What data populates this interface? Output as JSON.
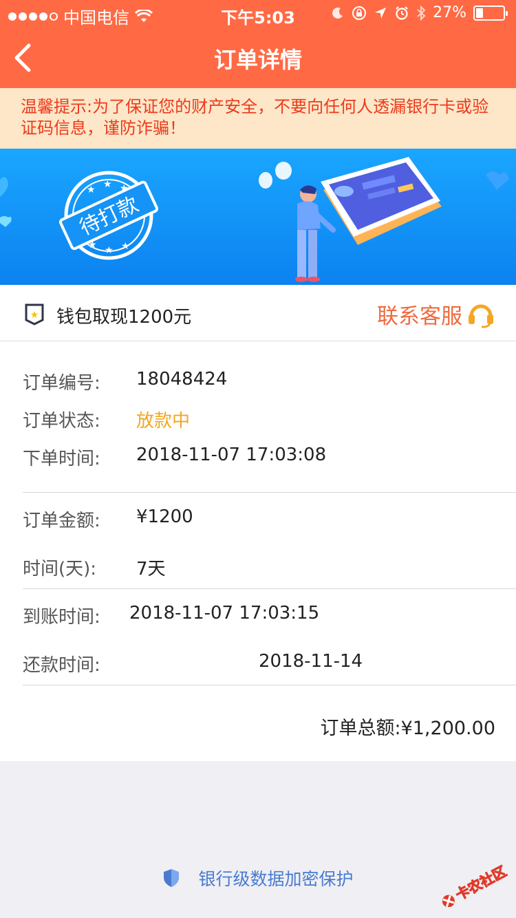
{
  "status_bar": {
    "carrier": "中国电信",
    "time": "下午5:03",
    "battery": "27%",
    "battery_level": 0.27
  },
  "nav": {
    "title": "订单详情"
  },
  "notice": {
    "text": "温馨提示:为了保证您的财产安全，不要向任何人透漏银行卡或验证码信息，谨防诈骗！"
  },
  "banner": {
    "stamp": "待打款"
  },
  "order_head": {
    "title": "钱包取现1200元",
    "service_label": "联系客服"
  },
  "details": {
    "order_no_label": "订单编号:",
    "order_no": "18048424",
    "status_label": "订单状态:",
    "status": "放款中",
    "placed_label": "下单时间:",
    "placed": "2018-11-07 17:03:08",
    "amount_label": "订单金额:",
    "amount": "¥1200",
    "term_label": "时间(天):",
    "term": "7天",
    "arrival_label": "到账时间:",
    "arrival": "2018-11-07 17:03:15",
    "repay_label": "还款时间:",
    "repay": "2018-11-14"
  },
  "total": {
    "label": "订单总额:",
    "value": "¥1,200.00"
  },
  "footer": {
    "text": "银行级数据加密保护"
  },
  "watermark": {
    "text": "卡农社区"
  },
  "colors": {
    "header": "#ff6a44",
    "notice_bg": "#fde7c8",
    "notice_text": "#ec3a1c",
    "status_orange": "#f2a61f",
    "service": "#ef6a3f",
    "footer_link": "#4a7bd0"
  }
}
